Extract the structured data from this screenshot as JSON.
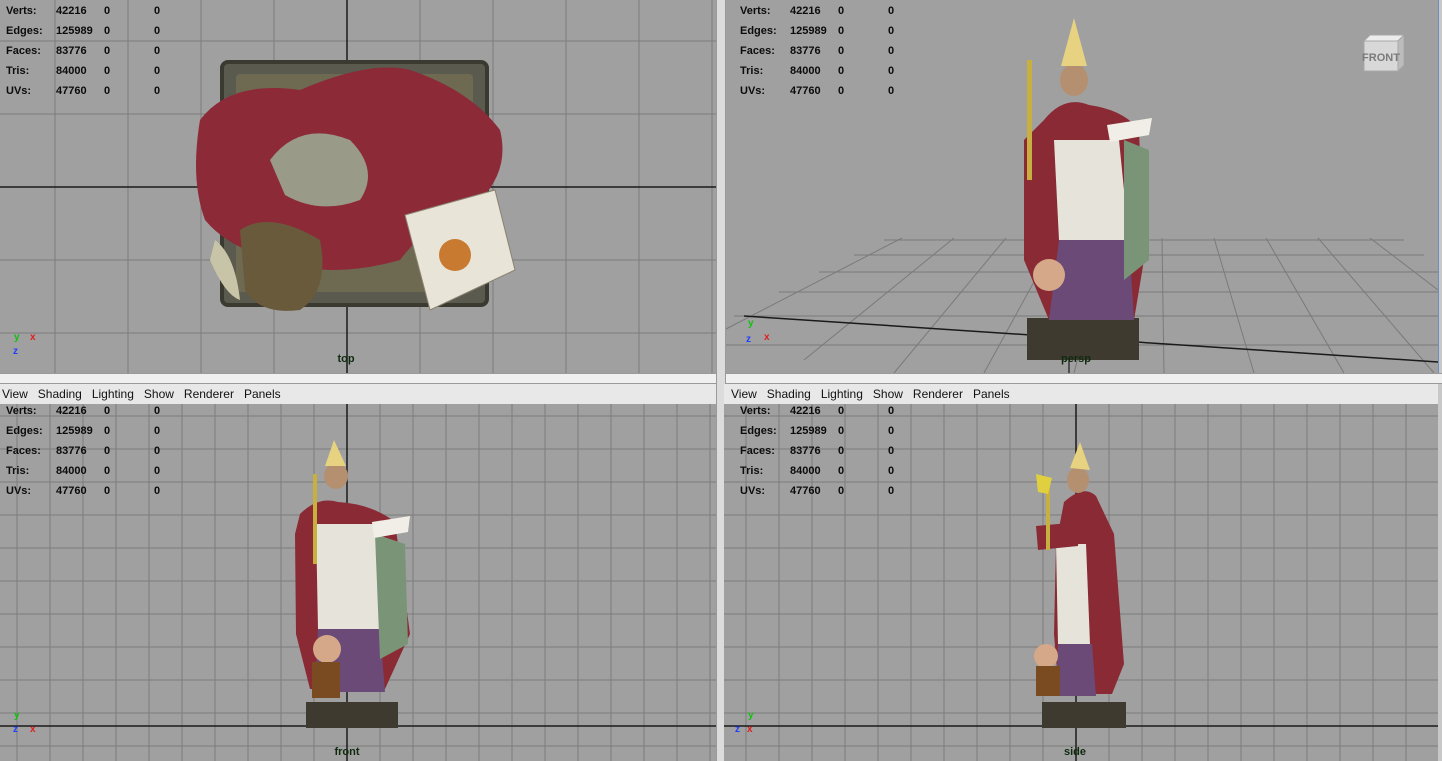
{
  "stats": [
    {
      "label": "Verts:",
      "value": "42216",
      "sel": "0",
      "comp": "0"
    },
    {
      "label": "Edges:",
      "value": "125989",
      "sel": "0",
      "comp": "0"
    },
    {
      "label": "Faces:",
      "value": "83776",
      "sel": "0",
      "comp": "0"
    },
    {
      "label": "Tris:",
      "value": "84000",
      "sel": "0",
      "comp": "0"
    },
    {
      "label": "UVs:",
      "value": "47760",
      "sel": "0",
      "comp": "0"
    }
  ],
  "viewports": {
    "top": {
      "camera": "top"
    },
    "persp": {
      "camera": "persp",
      "view_cube": "FRONT"
    },
    "front": {
      "camera": "front"
    },
    "side": {
      "camera": "side"
    }
  },
  "menubar": [
    "View",
    "Shading",
    "Lighting",
    "Show",
    "Renderer",
    "Panels"
  ],
  "axis_letters": {
    "x": "x",
    "y": "y",
    "z": "z"
  },
  "colors": {
    "background": "#a0a0a0",
    "grid": "#7c7c7c",
    "axis_line": "#1a1a1a",
    "x_axis": "#e02020",
    "y_axis": "#10c010",
    "z_axis": "#2040ff"
  }
}
